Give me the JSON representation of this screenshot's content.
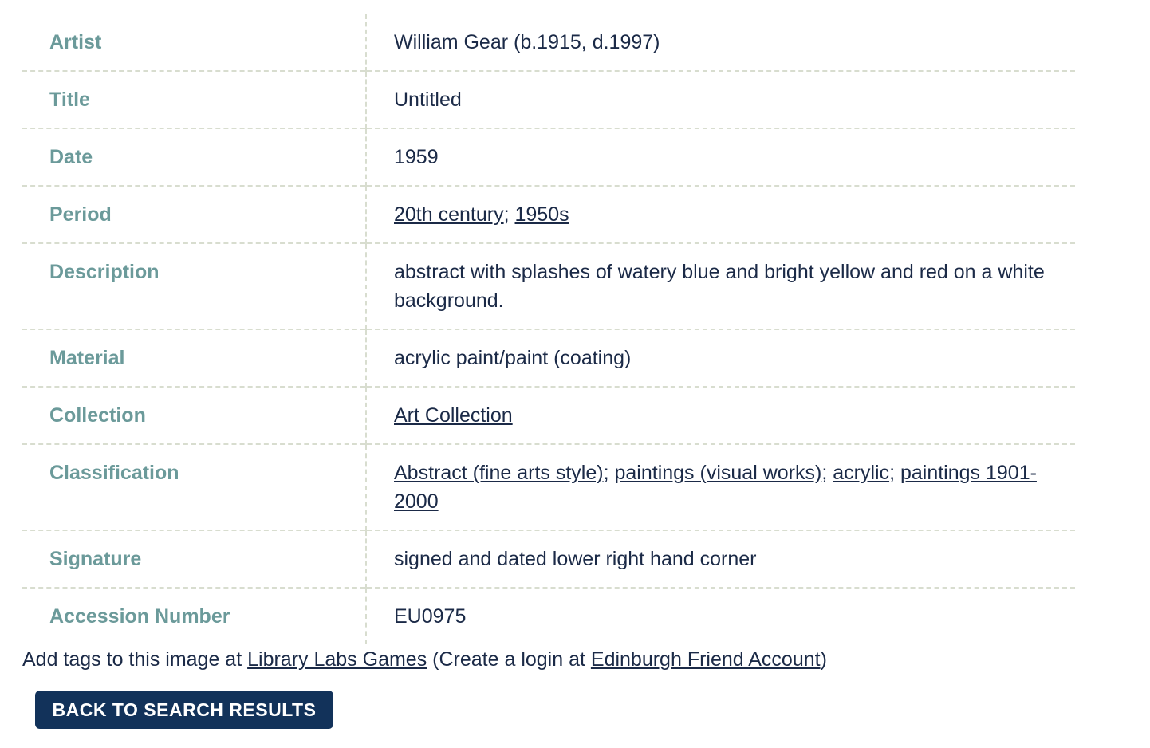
{
  "record": {
    "artist_label": "Artist",
    "artist_value": "William Gear (b.1915, d.1997)",
    "title_label": "Title",
    "title_value": "Untitled",
    "date_label": "Date",
    "date_value": "1959",
    "period_label": "Period",
    "period_links": [
      "20th century",
      "1950s"
    ],
    "description_label": "Description",
    "description_value": "abstract with splashes of watery blue and bright yellow and red on a white background.",
    "material_label": "Material",
    "material_value": "acrylic paint/paint (coating)",
    "collection_label": "Collection",
    "collection_link": "Art Collection",
    "classification_label": "Classification",
    "classification_links": [
      "Abstract (fine arts style)",
      "paintings (visual works)",
      "acrylic",
      "paintings 1901-2000"
    ],
    "signature_label": "Signature",
    "signature_value": "signed and dated lower right hand corner",
    "accession_label": "Accession Number",
    "accession_value": "EU0975"
  },
  "footer": {
    "prefix": "Add tags to this image at ",
    "games_link": "Library Labs Games",
    "middle": " (Create a login at ",
    "account_link": "Edinburgh Friend Account",
    "suffix": ")",
    "separator": "; "
  },
  "back_button_label": "BACK TO SEARCH RESULTS"
}
